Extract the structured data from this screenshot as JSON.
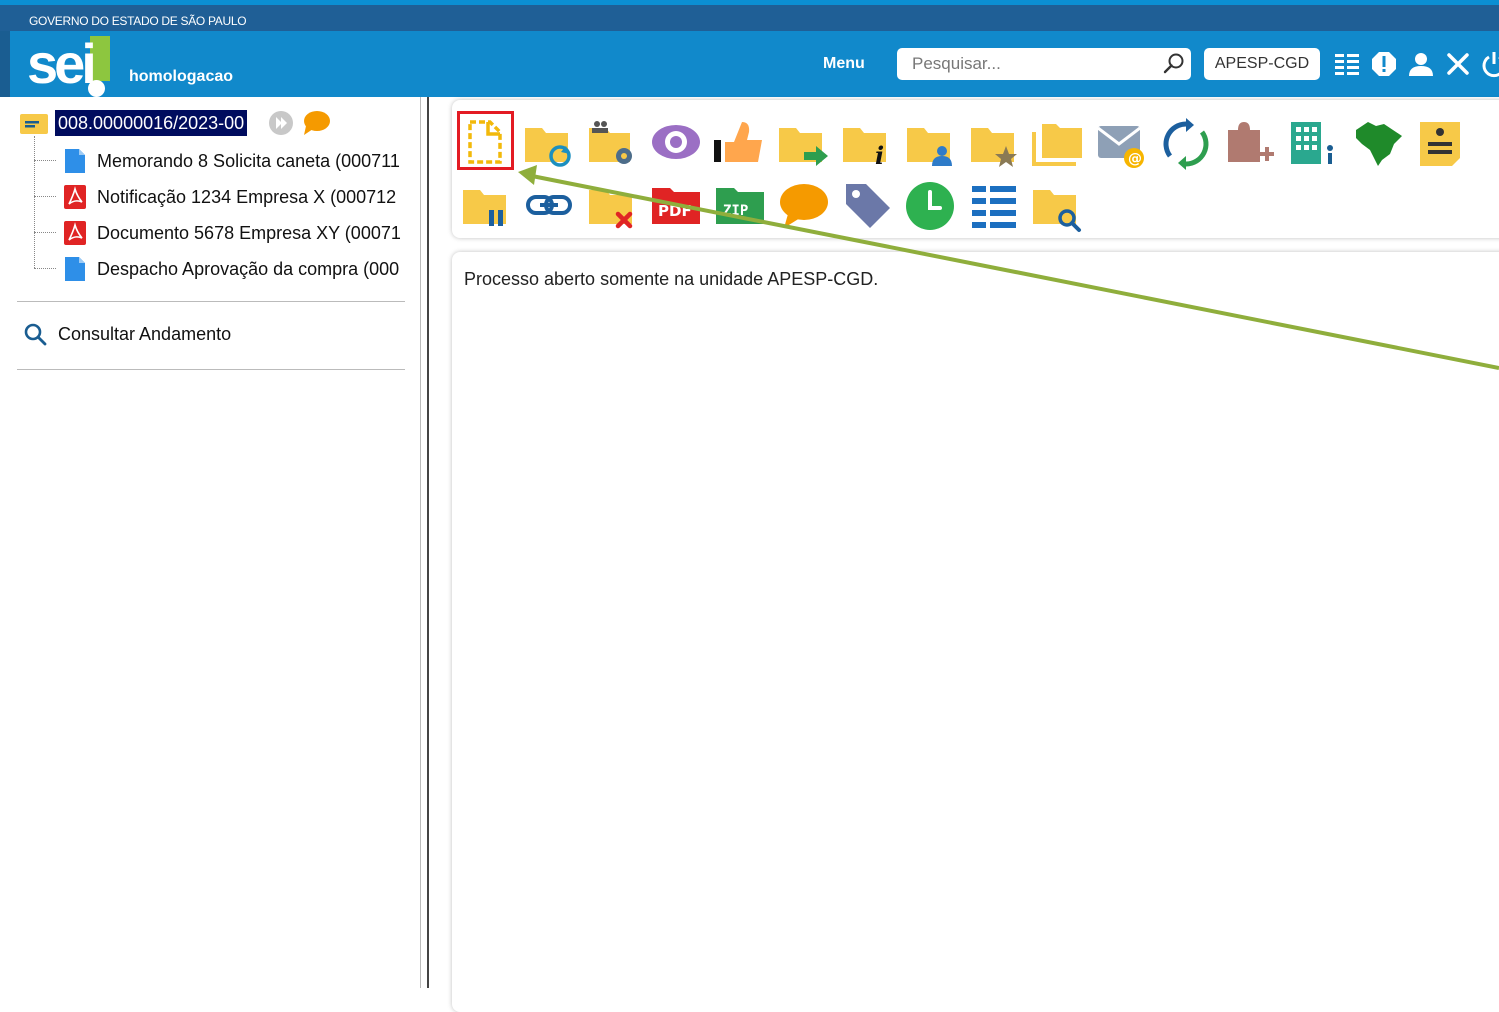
{
  "gov_bar": {
    "text": "GOVERNO DO ESTADO DE SÃO PAULO"
  },
  "header": {
    "logo": "sei",
    "environment": "homologacao",
    "menu_label": "Menu",
    "search_placeholder": "Pesquisar...",
    "unit": "APESP-CGD",
    "icons": [
      "list-icon",
      "alert-icon",
      "user-icon",
      "tools-icon",
      "power-icon"
    ]
  },
  "sidebar": {
    "process_number": "008.00000016/2023-00",
    "documents": [
      {
        "label": "Memorando 8 Solicita caneta (000711",
        "icon": "document-icon"
      },
      {
        "label": "Notificação 1234 Empresa X (000712",
        "icon": "pdf-icon"
      },
      {
        "label": "Documento 5678 Empresa XY (00071",
        "icon": "pdf-icon"
      },
      {
        "label": "Despacho Aprovação da compra (000",
        "icon": "document-icon"
      }
    ],
    "consult_label": "Consultar Andamento"
  },
  "toolbar": {
    "row1": [
      "new-document-icon",
      "process-sync-icon",
      "assign-icon",
      "view-icon",
      "like-icon",
      "send-icon",
      "info-icon",
      "user-folder-icon",
      "favorite-folder-icon",
      "folders-icon",
      "email-icon",
      "refresh-icon",
      "add-puzzle-icon",
      "building-icon",
      "brazil-map-icon",
      "note-icon"
    ],
    "row2": [
      "pause-folder-icon",
      "link-icon",
      "delete-folder-icon",
      "pdf-export-icon",
      "zip-icon",
      "comment-icon",
      "tag-icon",
      "clock-icon",
      "list-view-icon",
      "search-folder-icon"
    ]
  },
  "content": {
    "message": "Processo aberto somente na unidade APESP-CGD."
  },
  "colors": {
    "gov_bar": "#1f5f96",
    "header": "#1189cb",
    "logo_accent": "#8dc63f",
    "highlight": "#e31b23",
    "annotation_arrow": "#8fae3c",
    "folder": "#f7c948"
  }
}
